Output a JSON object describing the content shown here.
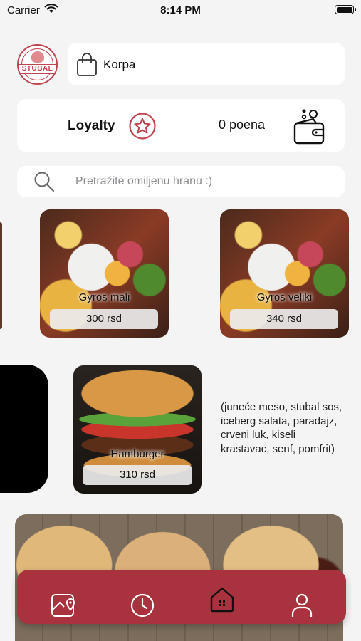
{
  "status_bar": {
    "carrier": "Carrier",
    "time": "8:14 PM",
    "wifi_icon": "wifi-icon",
    "battery_icon": "battery-icon"
  },
  "header": {
    "logo_text": "STUBAL",
    "cart_label": "Korpa",
    "cart_icon": "shopping-bag-icon"
  },
  "loyalty": {
    "title": "Loyalty",
    "points": "0 poena",
    "star_icon": "star-icon",
    "wallet_icon": "wallet-icon"
  },
  "search": {
    "placeholder": "Pretražite omiljenu hranu :)",
    "icon": "search-icon"
  },
  "products": [
    {
      "name": "Gyros mali",
      "price": "300 rsd"
    },
    {
      "name": "Gyros veliki",
      "price": "340 rsd"
    },
    {
      "name": "Hamburger",
      "price": "310 rsd",
      "description": "(juneće meso, stubal sos, iceberg salata, paradajz, crveni luk, kiseli krastavac, senf, pomfrit)"
    }
  ],
  "bottom_nav": {
    "items": [
      "map-location-icon",
      "history-clock-icon",
      "home-icon",
      "profile-icon"
    ],
    "active": "home-icon"
  },
  "colors": {
    "accent": "#a8323e",
    "brand_red": "#c0444d",
    "background": "#f4f4f5",
    "card": "#ffffff"
  }
}
